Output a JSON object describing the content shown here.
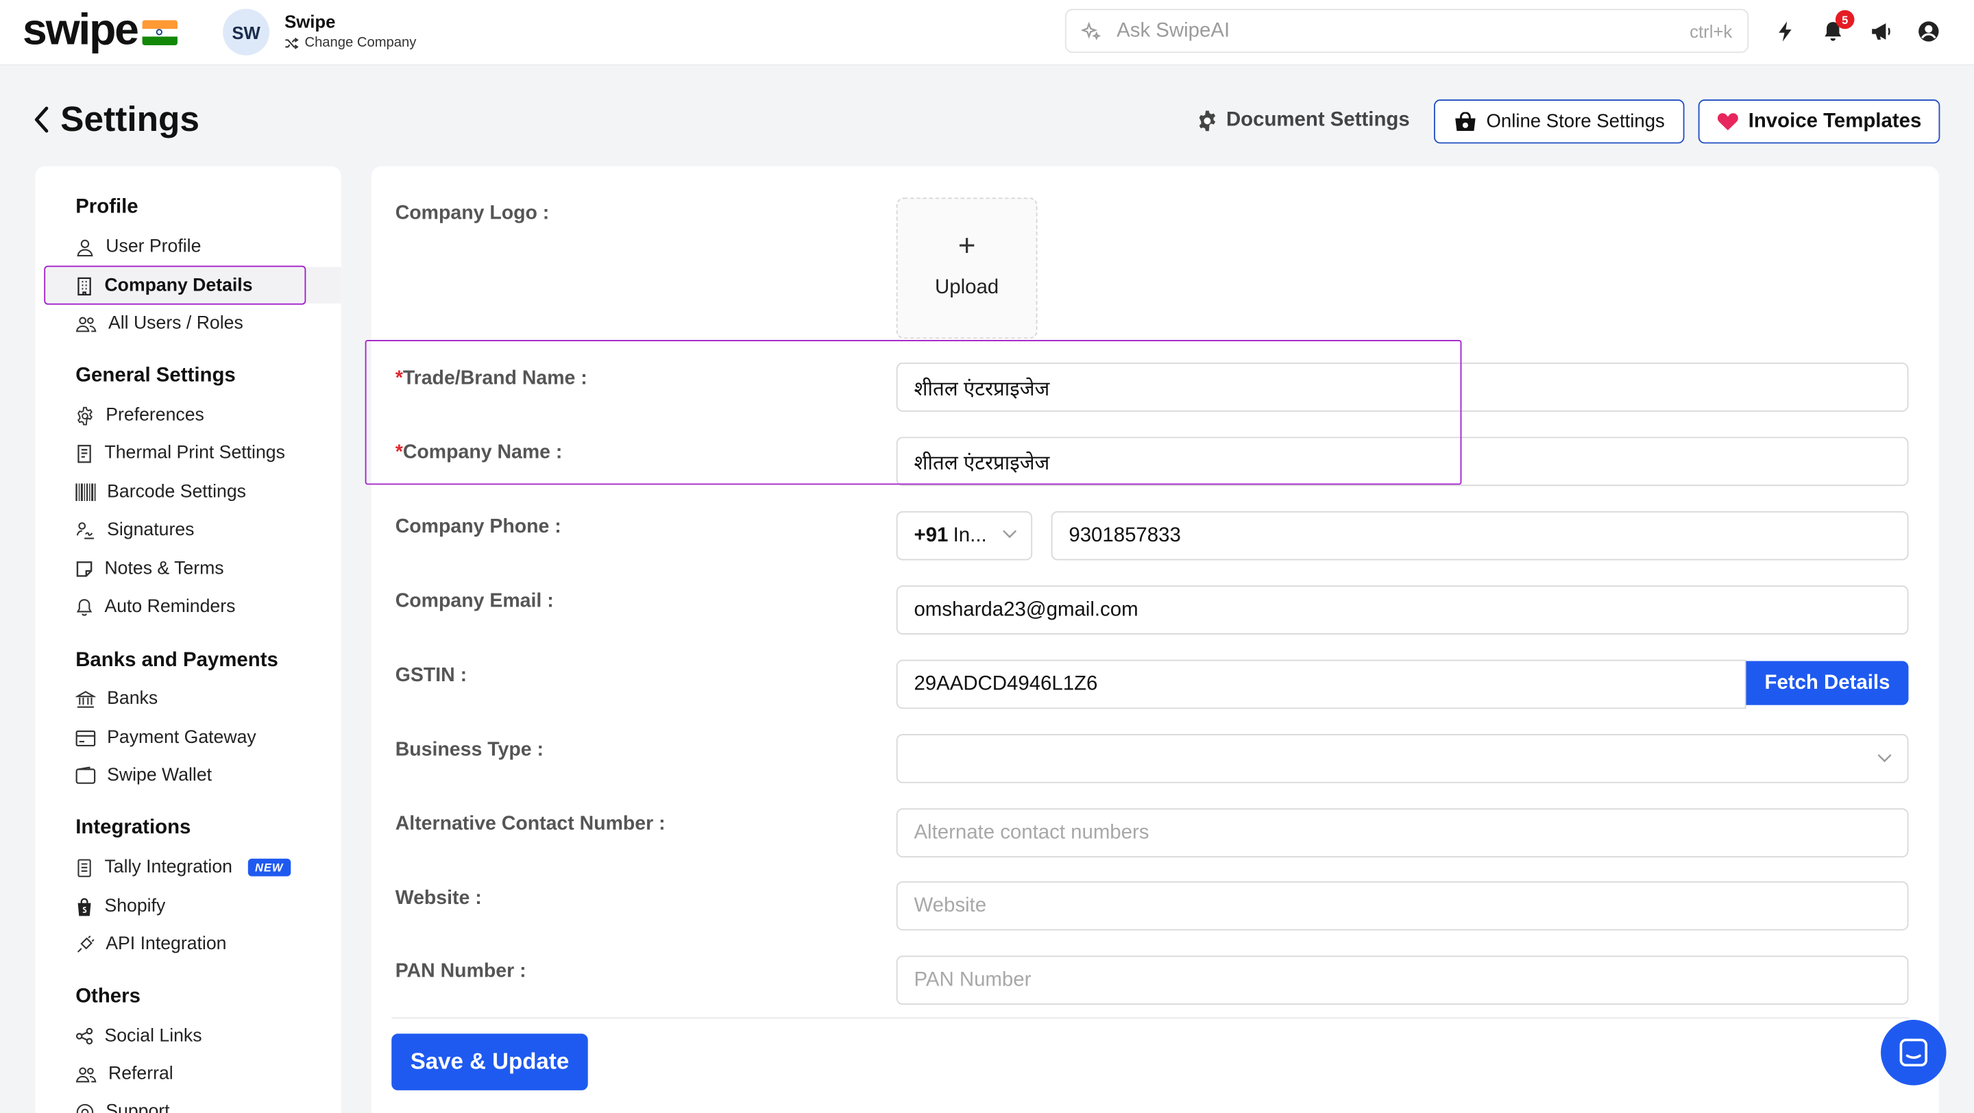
{
  "topbar": {
    "logo": "swipe",
    "avatar_initials": "SW",
    "company_name": "Swipe",
    "change_company": "Change Company",
    "search_placeholder": "Ask SwipeAI",
    "search_shortcut": "ctrl+k",
    "notifications_count": "5"
  },
  "header": {
    "title": "Settings",
    "document_settings": "Document Settings",
    "online_store_settings": "Online Store Settings",
    "invoice_templates": "Invoice Templates"
  },
  "sidebar": {
    "sections": [
      {
        "title": "Profile",
        "items": [
          "User Profile",
          "Company Details",
          "All Users / Roles"
        ]
      },
      {
        "title": "General Settings",
        "items": [
          "Preferences",
          "Thermal Print Settings",
          "Barcode Settings",
          "Signatures",
          "Notes & Terms",
          "Auto Reminders"
        ]
      },
      {
        "title": "Banks and Payments",
        "items": [
          "Banks",
          "Payment Gateway",
          "Swipe Wallet"
        ]
      },
      {
        "title": "Integrations",
        "items": [
          "Tally Integration",
          "Shopify",
          "API Integration"
        ]
      },
      {
        "title": "Others",
        "items": [
          "Social Links",
          "Referral",
          "Support"
        ]
      }
    ],
    "active_item": "Company Details",
    "new_badge": "NEW"
  },
  "form": {
    "logo_label": "Company Logo :",
    "upload_label": "Upload",
    "trade_name_label": "Trade/Brand Name :",
    "trade_name_value": "शीतल एंटरप्राइजेज",
    "company_name_label": "Company Name :",
    "company_name_value": "शीतल एंटरप्राइजेज",
    "required_mark": "*",
    "phone_label": "Company Phone :",
    "phone_code": "+91",
    "phone_country": "In...",
    "phone_value": "9301857833",
    "email_label": "Company Email :",
    "email_value": "omsharda23@gmail.com",
    "gstin_label": "GSTIN :",
    "gstin_value": "29AADCD4946L1Z6",
    "fetch_details": "Fetch Details",
    "business_type_label": "Business Type :",
    "alt_contact_label": "Alternative Contact Number :",
    "alt_contact_placeholder": "Alternate contact numbers",
    "website_label": "Website :",
    "website_placeholder": "Website",
    "pan_label": "PAN Number :",
    "pan_placeholder": "PAN Number",
    "save_button": "Save & Update"
  },
  "colors": {
    "primary": "#1f5af0",
    "highlight": "#a21fc9",
    "badge": "#e51c23"
  }
}
